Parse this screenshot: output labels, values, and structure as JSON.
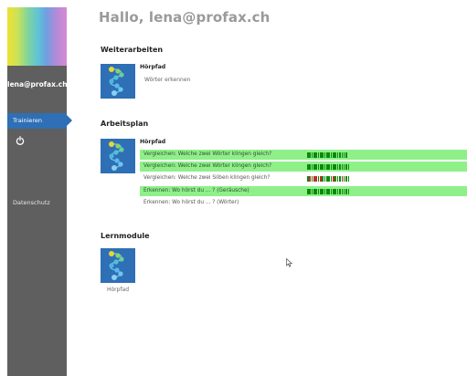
{
  "sidebar": {
    "user": "lena@profax.ch",
    "nav_training": "Trainieren",
    "nav_privacy": "Datenschutz"
  },
  "header": {
    "title": "Hallo, lena@profax.ch"
  },
  "continue": {
    "section_title": "Weiterarbeiten",
    "item_title": "Hörpfad",
    "item_subtitle": "Wörter erkennen"
  },
  "plan": {
    "section_title": "Arbeitsplan",
    "item_title": "Hörpfad",
    "rows": [
      {
        "label": "Vergleichen: Welche zwei Wörter klingen gleich?",
        "highlight": true,
        "progress": 0.95
      },
      {
        "label": "Vergleichen: Welche zwei Wörter klingen gleich?",
        "highlight": true,
        "progress": 1.0
      },
      {
        "label": "Vergleichen: Welche zwei Silben klingen gleich?",
        "highlight": false,
        "progress": 1.0
      },
      {
        "label": "Erkennen: Wo hörst du ... ? (Geräusche)",
        "highlight": true,
        "progress": 1.0
      },
      {
        "label": "Erkennen: Wo hörst du ... ? (Wörter)",
        "highlight": false,
        "progress": 0
      }
    ]
  },
  "modules": {
    "section_title": "Lernmodule",
    "items": [
      {
        "label": "Hörpfad"
      }
    ]
  },
  "colors": {
    "accent": "#2f6fb5",
    "highlight": "#8ff08a",
    "sidebar": "#5f5f5f",
    "progress_ok": "#0a8a0a",
    "progress_error": "#c0302a"
  }
}
